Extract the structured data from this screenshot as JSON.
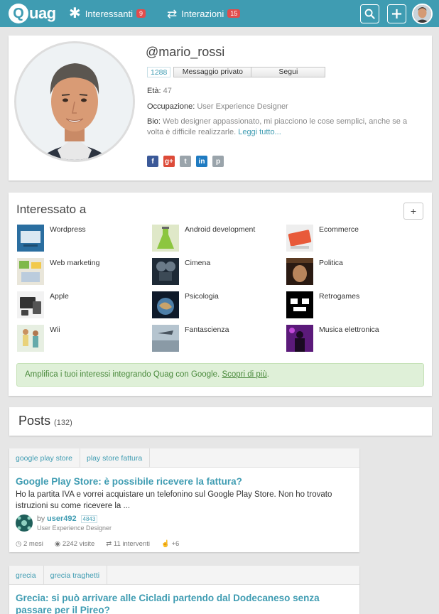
{
  "topbar": {
    "logo_q": "Q",
    "logo_rest": "uag",
    "nav": [
      {
        "label": "Interessanti",
        "badge": "9",
        "icon": "asterisk-icon"
      },
      {
        "label": "Interazioni",
        "badge": "15",
        "icon": "exchange-icon"
      }
    ],
    "accent": "#3f9cb2"
  },
  "profile": {
    "username": "@mario_rossi",
    "followers": "1288",
    "message_label": "Messaggio privato",
    "follow_label": "Segui",
    "age_label": "Età:",
    "age": "47",
    "occupation_label": "Occupazione:",
    "occupation": "User Experience Designer",
    "bio_label": "Bio:",
    "bio": "Web designer appassionato, mi piacciono le cose semplici, anche se a volta è difficile realizzarle.",
    "read_more": "Leggi tutto...",
    "socials": [
      "facebook-icon",
      "google-plus-icon",
      "twitter-icon",
      "linkedin-icon",
      "pinterest-icon"
    ]
  },
  "interests": {
    "title": "Interessato a",
    "add_label": "+",
    "items": [
      {
        "label": "Wordpress"
      },
      {
        "label": "Android development"
      },
      {
        "label": "Ecommerce"
      },
      {
        "label": "Web marketing"
      },
      {
        "label": "Cimena"
      },
      {
        "label": "Politica"
      },
      {
        "label": "Apple"
      },
      {
        "label": "Psicologia"
      },
      {
        "label": "Retrogames"
      },
      {
        "label": "Wii"
      },
      {
        "label": "Fantascienza"
      },
      {
        "label": "Musica elettronica"
      }
    ],
    "info_text": "Amplifica i tuoi interessi integrando Quag con Google.",
    "info_link": "Scopri di più",
    "info_end": "."
  },
  "posts": {
    "title": "Posts",
    "count": "(132)",
    "items": [
      {
        "tags": [
          "google play store",
          "play store fattura"
        ],
        "title": "Google Play Store: è possibile ricevere la fattura?",
        "excerpt": "Ho la partita IVA e vorrei acquistare un telefonino sul Google Play Store. Non ho trovato istruzioni su come ricevere la ...",
        "by": "by",
        "author": "user492",
        "rep": "4843",
        "occupation": "User Experience Designer",
        "time": "2 mesi",
        "views": "2242 visite",
        "replies": "11 interventi",
        "likes": "+6"
      },
      {
        "tags": [
          "grecia",
          "grecia traghetti"
        ],
        "title": "Grecia: si può arrivare alle Cicladi partendo dal Dodecaneso senza passare per il Pireo?"
      }
    ]
  }
}
